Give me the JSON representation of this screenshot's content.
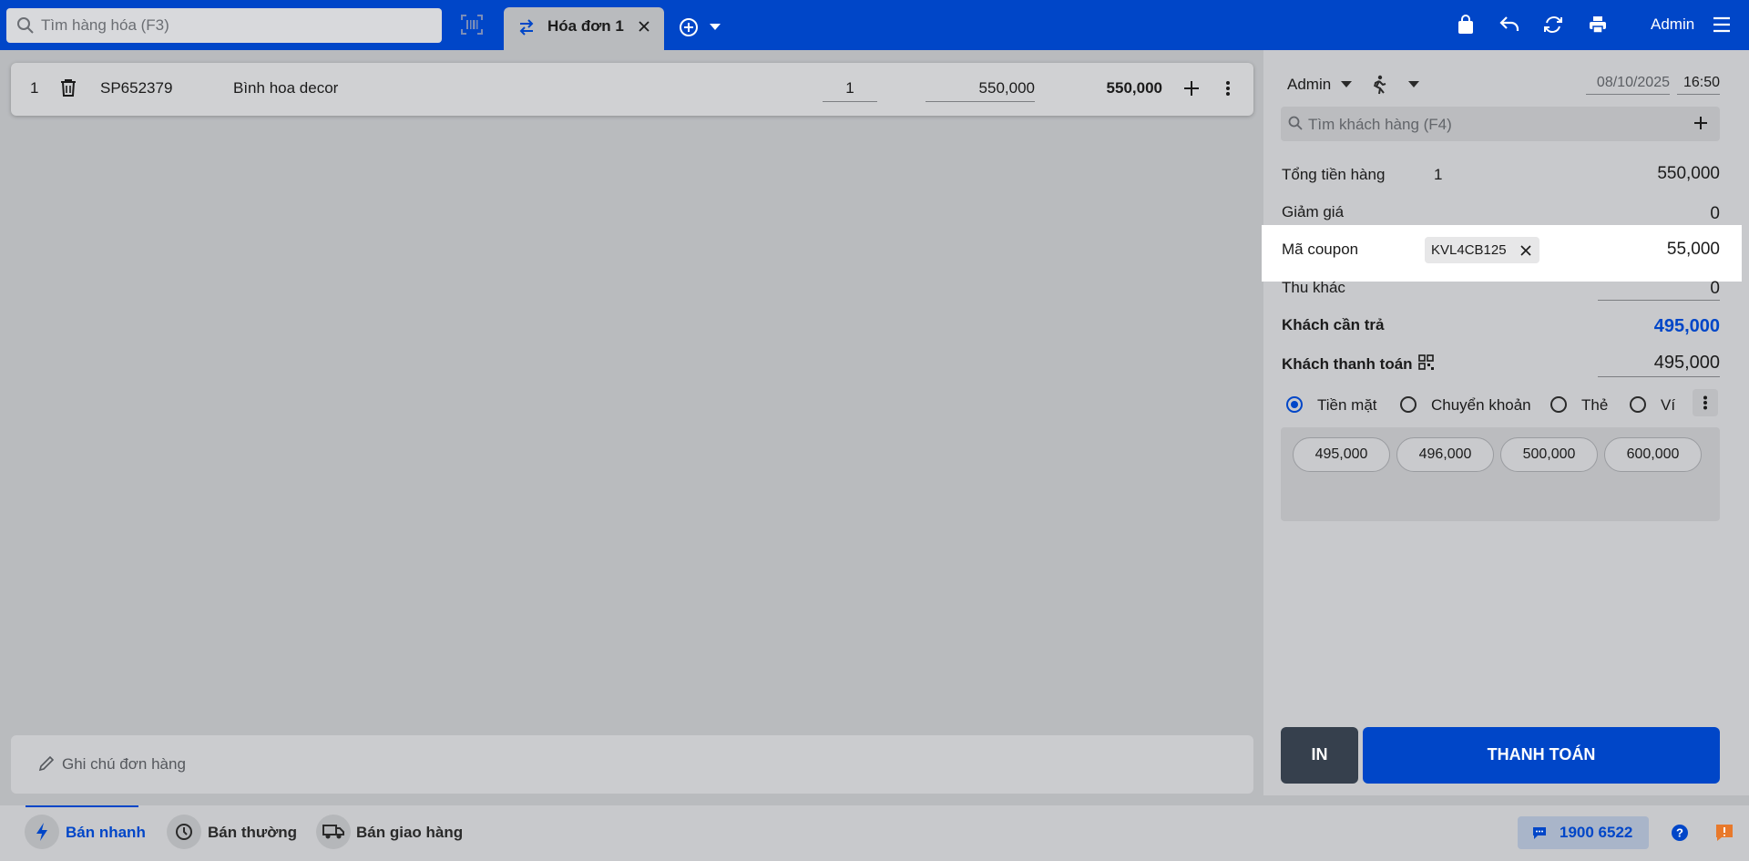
{
  "colors": {
    "brand": "#0046c8",
    "dark_button": "#36404d",
    "highlight": "#ffffff"
  },
  "header": {
    "search_placeholder": "Tìm hàng hóa (F3)",
    "active_tab": "Hóa đơn 1",
    "user": "Admin",
    "icons": [
      "search-icon",
      "barcode-icon",
      "swap-icon",
      "close-icon",
      "add-circle-icon",
      "chevron-down-icon",
      "bag-icon",
      "undo-icon",
      "refresh-icon",
      "print-icon",
      "menu-icon"
    ]
  },
  "order_row": {
    "index": "1",
    "code": "SP652379",
    "name": "Bình hoa decor",
    "quantity": "1",
    "unit_price": "550,000",
    "line_total": "550,000"
  },
  "note": {
    "placeholder": "Ghi chú đơn hàng"
  },
  "panel": {
    "seller": "Admin",
    "date": "08/10/2025",
    "time": "16:50",
    "customer_placeholder": "Tìm khách hàng (F4)",
    "subtotal_label": "Tổng tiền hàng",
    "subtotal_count": "1",
    "subtotal_value": "550,000",
    "discount_label": "Giảm giá",
    "discount_value": "0",
    "coupon_label": "Mã coupon",
    "coupon_code": "KVL4CB125",
    "coupon_value": "55,000",
    "other_label": "Thu khác",
    "other_value": "0",
    "due_label": "Khách cần trả",
    "due_value": "495,000",
    "paid_label": "Khách thanh toán",
    "paid_value": "495,000",
    "methods": [
      "Tiền mặt",
      "Chuyển khoản",
      "Thẻ",
      "Ví"
    ],
    "selected_method": "Tiền mặt",
    "quick_amounts": [
      "495,000",
      "496,000",
      "500,000",
      "600,000"
    ],
    "print_label": "IN",
    "pay_label": "THANH TOÁN"
  },
  "bottom": {
    "modes": [
      "Bán nhanh",
      "Bán thường",
      "Bán giao hàng"
    ],
    "active_mode": "Bán nhanh",
    "hotline": "1900 6522"
  }
}
